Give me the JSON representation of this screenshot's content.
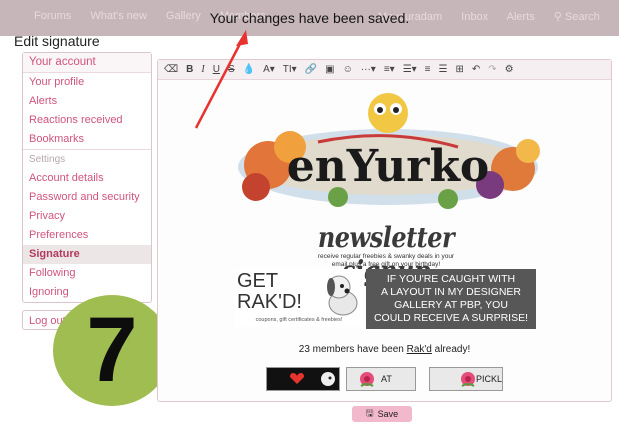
{
  "nav": {
    "left_items": [
      "Forums",
      "What's new",
      "Gallery",
      "Members"
    ],
    "right_items": [
      "Meyouradam",
      "Inbox",
      "Alerts",
      "Search"
    ]
  },
  "toast": "Your changes have been saved.",
  "page_title": "Edit signature",
  "sidebar": {
    "items": [
      {
        "label": "Your account",
        "kind": "header"
      },
      {
        "label": "Your profile",
        "kind": "link"
      },
      {
        "label": "Alerts",
        "kind": "link"
      },
      {
        "label": "Reactions received",
        "kind": "link"
      },
      {
        "label": "Bookmarks",
        "kind": "link"
      },
      {
        "label": "Settings",
        "kind": "section"
      },
      {
        "label": "Account details",
        "kind": "link"
      },
      {
        "label": "Password and security",
        "kind": "link"
      },
      {
        "label": "Privacy",
        "kind": "link"
      },
      {
        "label": "Preferences",
        "kind": "link"
      },
      {
        "label": "Signature",
        "kind": "selected"
      },
      {
        "label": "Following",
        "kind": "link"
      },
      {
        "label": "Ignoring",
        "kind": "link"
      }
    ],
    "logout": "Log out"
  },
  "badge_number": "7",
  "toolbar": {
    "buttons": [
      "eraser-icon",
      "B",
      "I",
      "U",
      "S",
      "drop-icon",
      "A▾",
      "TI▾",
      "link-icon",
      "image-icon",
      "smiley-icon",
      "···▾",
      "≡▾",
      "☰▾",
      "list-icon",
      "ordered-list-icon",
      "table-icon",
      "undo-icon",
      "redo-icon",
      "gear-icon"
    ]
  },
  "signature": {
    "banner_text": "enYurko",
    "newsletter_title": "newsletter signup",
    "newsletter_sub_1": "receive regular freebies & swanky deals in your",
    "newsletter_sub_2": "email plus a free gift on your birthday!",
    "rak_head_1": "GET",
    "rak_head_2": "RAK'D!",
    "rak_foot": "coupons, gift certificates & freebies!",
    "rak_right_1": "IF YOU'RE CAUGHT WITH",
    "rak_right_2": "A LAYOUT IN MY DESIGNER",
    "rak_right_3": "GALLERY AT PBP, YOU",
    "rak_right_4": "COULD RECEIVE A SURPRISE!",
    "count_pre": "23 members have been ",
    "count_link": "Rak'd",
    "count_post": " already!",
    "btn2_label": "AT",
    "btn3_label": "PICKL"
  },
  "save_label": "Save",
  "colors": {
    "accent": "#d0557d",
    "save_button": "#f2b9cc",
    "badge": "#9fbd50",
    "arrow": "#e8322e"
  }
}
